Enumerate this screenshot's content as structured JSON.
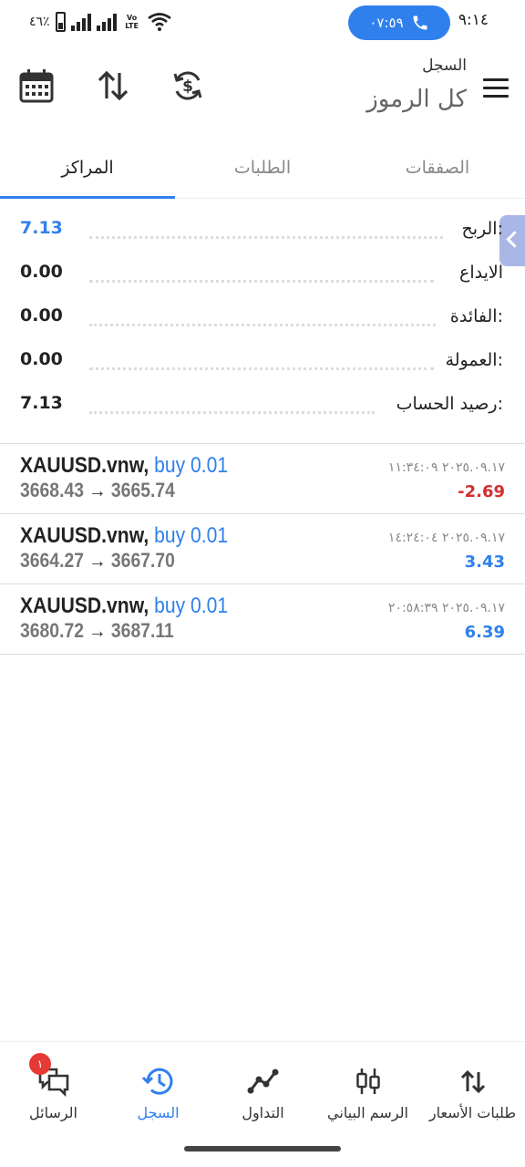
{
  "status_bar": {
    "time": "٩:١٤",
    "call_duration": "٠٧:٥٩",
    "battery_percent": "٤٦٪"
  },
  "header": {
    "subtitle": "السجل",
    "title": "كل الرموز",
    "icons": [
      "menu-icon",
      "currency-exchange-icon",
      "sort-icon",
      "calendar-icon"
    ]
  },
  "tabs": [
    {
      "label": "الصفقات",
      "active": false
    },
    {
      "label": "الطلبات",
      "active": false
    },
    {
      "label": "المراكز",
      "active": true
    }
  ],
  "summary": [
    {
      "label": "الربح:",
      "value": "7.13",
      "color": "#2f80ed"
    },
    {
      "label": "الايداع",
      "value": "0.00"
    },
    {
      "label": "الفائدة:",
      "value": "0.00"
    },
    {
      "label": "العمولة:",
      "value": "0.00"
    },
    {
      "label": "رصيد الحساب:",
      "value": "7.13"
    }
  ],
  "deals": [
    {
      "symbol": "XAUUSD.vnw,",
      "side": "buy 0.01",
      "open_price": "3668.43",
      "close_price": "3665.74",
      "datetime": "٢٠٢٥.٠٩.١٧ ١١:٣٤:٠٩",
      "profit": "-2.69",
      "profit_color": "#d32f2f"
    },
    {
      "symbol": "XAUUSD.vnw,",
      "side": "buy 0.01",
      "open_price": "3664.27",
      "close_price": "3667.70",
      "datetime": "٢٠٢٥.٠٩.١٧ ١٤:٢٤:٠٤",
      "profit": "3.43",
      "profit_color": "#2f80ed"
    },
    {
      "symbol": "XAUUSD.vnw,",
      "side": "buy 0.01",
      "open_price": "3680.72",
      "close_price": "3687.11",
      "datetime": "٢٠٢٥.٠٩.١٧ ٢٠:٥٨:٣٩",
      "profit": "6.39",
      "profit_color": "#2f80ed"
    }
  ],
  "bottom_nav": [
    {
      "label": "طلبات الأسعار",
      "icon": "quotes-icon"
    },
    {
      "label": "الرسم البياني",
      "icon": "candlestick-icon"
    },
    {
      "label": "التداول",
      "icon": "trade-icon"
    },
    {
      "label": "السجل",
      "icon": "history-icon",
      "active": true
    },
    {
      "label": "الرسائل",
      "icon": "messages-icon",
      "badge": "١"
    }
  ],
  "colors": {
    "accent": "#2f80ed",
    "negative": "#d32f2f",
    "badge": "#e53935"
  }
}
